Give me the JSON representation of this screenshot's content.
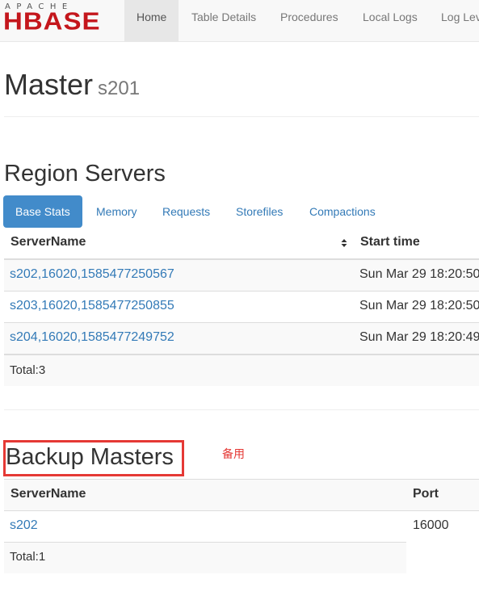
{
  "navbar": {
    "logo_top": "APACHE",
    "logo_main": "HBASE",
    "items": [
      {
        "label": "Home"
      },
      {
        "label": "Table Details"
      },
      {
        "label": "Procedures"
      },
      {
        "label": "Local Logs"
      },
      {
        "label": "Log Lev"
      }
    ]
  },
  "header": {
    "title": "Master",
    "host": "s201"
  },
  "region_servers": {
    "title": "Region Servers",
    "tabs": [
      {
        "label": "Base Stats"
      },
      {
        "label": "Memory"
      },
      {
        "label": "Requests"
      },
      {
        "label": "Storefiles"
      },
      {
        "label": "Compactions"
      }
    ],
    "columns": [
      "ServerName",
      "Start time"
    ],
    "rows": [
      {
        "server": "s202,16020,1585477250567",
        "start": "Sun Mar 29 18:20:50"
      },
      {
        "server": "s203,16020,1585477250855",
        "start": "Sun Mar 29 18:20:50"
      },
      {
        "server": "s204,16020,1585477249752",
        "start": "Sun Mar 29 18:20:49"
      }
    ],
    "total": "Total:3"
  },
  "backup_masters": {
    "title": "Backup Masters",
    "annotation": "备用",
    "columns": [
      "ServerName",
      "Port"
    ],
    "rows": [
      {
        "server": "s202",
        "port": "16000"
      }
    ],
    "total": "Total:1"
  },
  "colors": {
    "accent": "#428bca",
    "link": "#337ab7",
    "brand": "#c4161c",
    "annotation": "#e53935"
  }
}
